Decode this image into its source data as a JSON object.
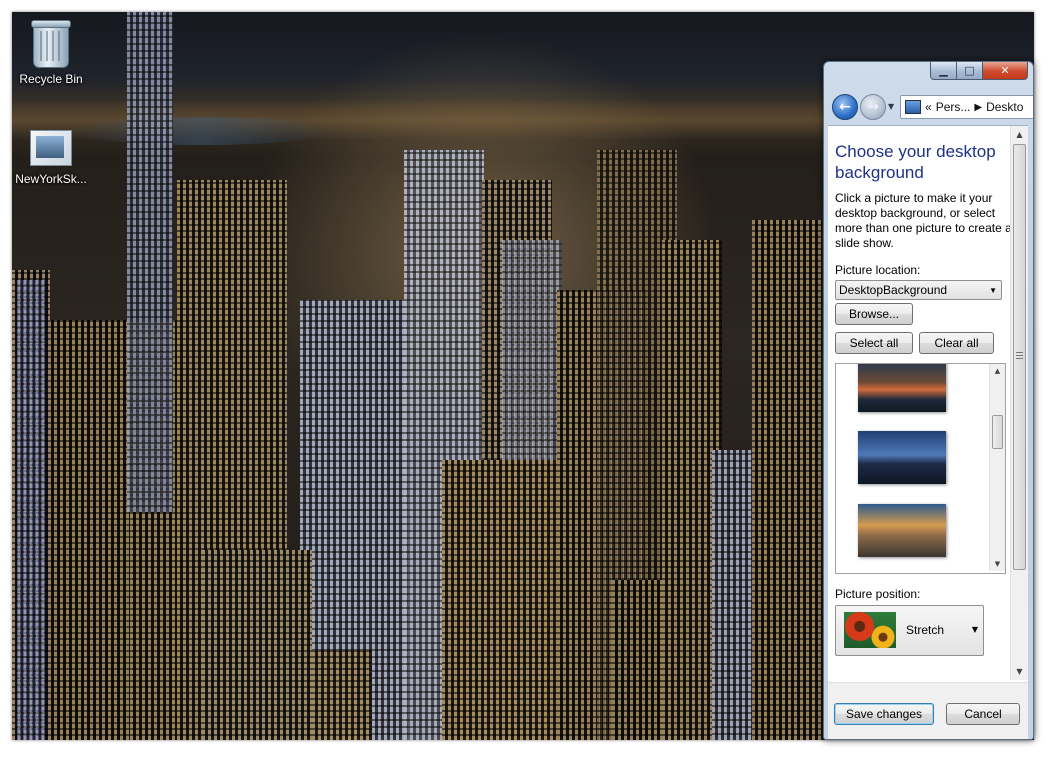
{
  "desktop": {
    "icons": [
      {
        "label": "Recycle Bin",
        "icon": "recycle-bin-icon"
      },
      {
        "label": "NewYorkSk...",
        "icon": "image-file-icon"
      }
    ]
  },
  "window": {
    "caption_buttons": {
      "minimize": "▁",
      "maximize": "□",
      "close": "✕"
    },
    "address": {
      "prefix": "«",
      "crumbs": [
        "Pers...",
        "Deskto"
      ]
    },
    "title": "Choose your desktop background",
    "description": "Click a picture to make it your desktop background, or select more than one picture to create a slide show.",
    "picture_location_label": "Picture location:",
    "picture_location_value": "DesktopBackground",
    "browse_button": "Browse...",
    "select_all_button": "Select all",
    "clear_all_button": "Clear all",
    "thumbnails": [
      {
        "name": "bridge-night-thumbnail"
      },
      {
        "name": "city-blue-thumbnail"
      },
      {
        "name": "city-sunset-thumbnail"
      }
    ],
    "picture_position_label": "Picture position:",
    "picture_position_value": "Stretch",
    "save_button": "Save changes",
    "cancel_button": "Cancel"
  }
}
